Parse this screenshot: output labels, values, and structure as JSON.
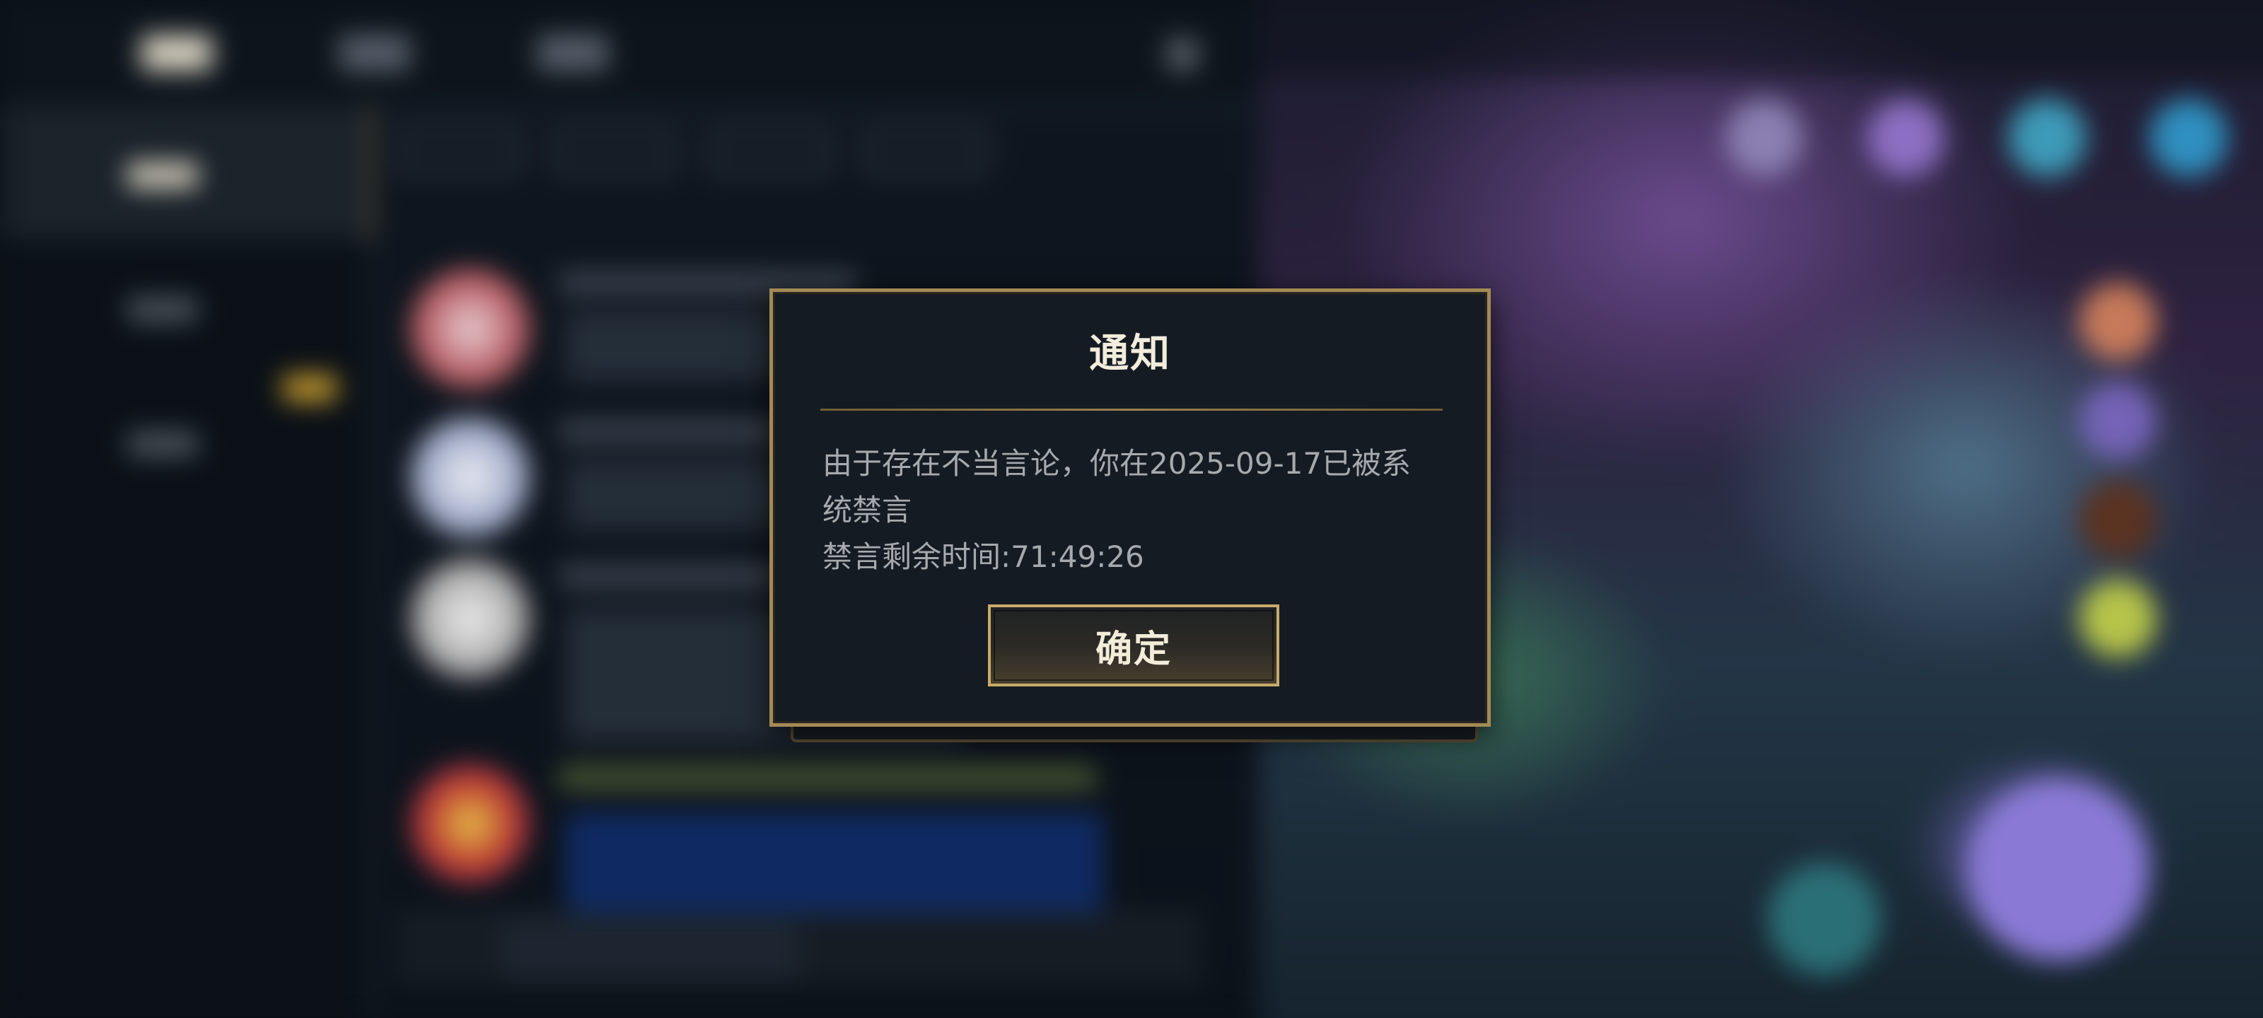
{
  "app": {
    "name": "chat-client"
  },
  "dialog": {
    "title": "通知",
    "message_lines": [
      "由于存在不当言论，你在2025-09-17已被系",
      "统禁言",
      "禁言剩余时间:71:49:26"
    ],
    "confirm_label": "确定"
  },
  "colors": {
    "dialog_border": "#a38a55",
    "dialog_bg": "#151b22",
    "title_text": "#f1ecdc",
    "body_text": "#a6a9ad",
    "button_border": "#c8aa6a"
  },
  "icons": {
    "background_icons": [
      "avatar-icon",
      "close-icon",
      "trash-icon",
      "emoji-icon",
      "image-icon"
    ]
  }
}
